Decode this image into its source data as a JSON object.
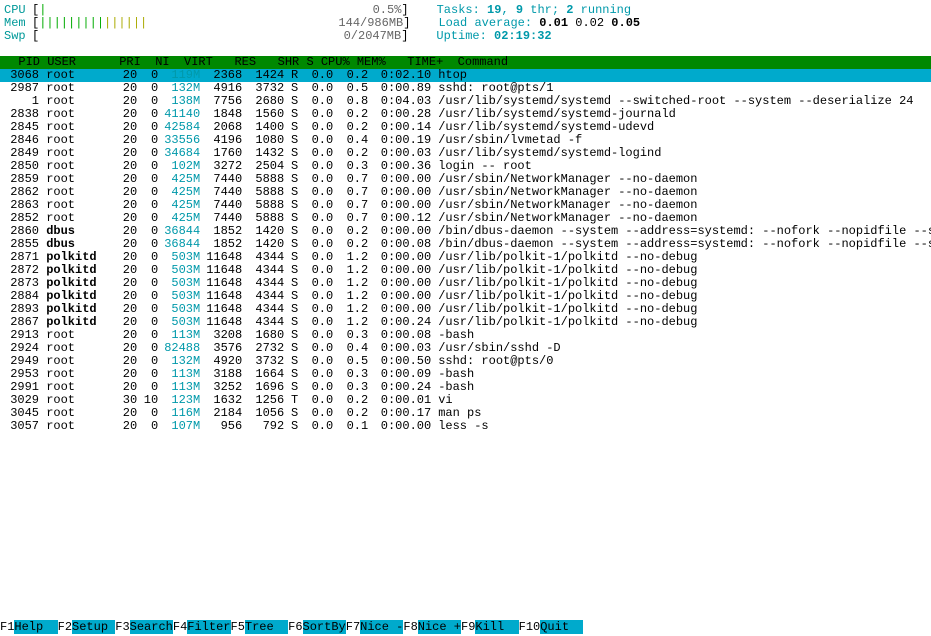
{
  "meters": {
    "cpu": {
      "label": "CPU",
      "bar": "|",
      "value": "0.5%"
    },
    "mem": {
      "label": "Mem",
      "bar_green": "|||||||||",
      "bar_yellow": "||||||",
      "value": "144/986MB"
    },
    "swp": {
      "label": "Swp",
      "bar": "",
      "value": "0/2047MB"
    }
  },
  "stats": {
    "tasks_label": "Tasks: ",
    "tasks_n": "19",
    "tasks_sep": ", ",
    "thr_n": "9",
    "thr_label": " thr; ",
    "running_n": "2",
    "running_label": " running",
    "load_label": "Load average: ",
    "load1": "0.01",
    "load2": "0.02",
    "load3": "0.05",
    "uptime_label": "Uptime: ",
    "uptime": "02:19:32"
  },
  "columns": "  PID USER      PRI  NI  VIRT   RES   SHR S CPU% MEM%   TIME+  Command",
  "processes": [
    {
      "selected": true,
      "pid": "3068",
      "user": "root",
      "pri": "20",
      "ni": "0",
      "virt": "119M",
      "res": "2368",
      "shr": "1424",
      "s": "R",
      "cpu": "0.0",
      "mem": "0.2",
      "time": "0:02.10",
      "cmd": "htop"
    },
    {
      "pid": "2987",
      "user": "root",
      "pri": "20",
      "ni": "0",
      "virt": "132M",
      "res": "4916",
      "shr": "3732",
      "s": "S",
      "cpu": "0.0",
      "mem": "0.5",
      "time": "0:00.89",
      "cmd": "sshd: root@pts/1"
    },
    {
      "pid": "1",
      "user": "root",
      "pri": "20",
      "ni": "0",
      "virt": "138M",
      "res": "7756",
      "shr": "2680",
      "s": "S",
      "cpu": "0.0",
      "mem": "0.8",
      "time": "0:04.03",
      "cmd": "/usr/lib/systemd/systemd --switched-root --system --deserialize 24"
    },
    {
      "pid": "2838",
      "user": "root",
      "pri": "20",
      "ni": "0",
      "virt": "41140",
      "res": "1848",
      "shr": "1560",
      "s": "S",
      "cpu": "0.0",
      "mem": "0.2",
      "time": "0:00.28",
      "cmd": "/usr/lib/systemd/systemd-journald"
    },
    {
      "pid": "2845",
      "user": "root",
      "pri": "20",
      "ni": "0",
      "virt": "42584",
      "res": "2068",
      "shr": "1400",
      "s": "S",
      "cpu": "0.0",
      "mem": "0.2",
      "time": "0:00.14",
      "cmd": "/usr/lib/systemd/systemd-udevd"
    },
    {
      "pid": "2846",
      "user": "root",
      "pri": "20",
      "ni": "0",
      "virt": "33556",
      "res": "4196",
      "shr": "1080",
      "s": "S",
      "cpu": "0.0",
      "mem": "0.4",
      "time": "0:00.19",
      "cmd": "/usr/sbin/lvmetad -f"
    },
    {
      "pid": "2849",
      "user": "root",
      "pri": "20",
      "ni": "0",
      "virt": "34684",
      "res": "1760",
      "shr": "1432",
      "s": "S",
      "cpu": "0.0",
      "mem": "0.2",
      "time": "0:00.03",
      "cmd": "/usr/lib/systemd/systemd-logind"
    },
    {
      "pid": "2850",
      "user": "root",
      "pri": "20",
      "ni": "0",
      "virt": "102M",
      "res": "3272",
      "shr": "2504",
      "s": "S",
      "cpu": "0.0",
      "mem": "0.3",
      "time": "0:00.36",
      "cmd": "login -- root"
    },
    {
      "pid": "2859",
      "user": "root",
      "pri": "20",
      "ni": "0",
      "virt": "425M",
      "res": "7440",
      "shr": "5888",
      "s": "S",
      "cpu": "0.0",
      "mem": "0.7",
      "time": "0:00.00",
      "cmd": "/usr/sbin/NetworkManager --no-daemon"
    },
    {
      "pid": "2862",
      "user": "root",
      "pri": "20",
      "ni": "0",
      "virt": "425M",
      "res": "7440",
      "shr": "5888",
      "s": "S",
      "cpu": "0.0",
      "mem": "0.7",
      "time": "0:00.00",
      "cmd": "/usr/sbin/NetworkManager --no-daemon"
    },
    {
      "pid": "2863",
      "user": "root",
      "pri": "20",
      "ni": "0",
      "virt": "425M",
      "res": "7440",
      "shr": "5888",
      "s": "S",
      "cpu": "0.0",
      "mem": "0.7",
      "time": "0:00.00",
      "cmd": "/usr/sbin/NetworkManager --no-daemon"
    },
    {
      "pid": "2852",
      "user": "root",
      "pri": "20",
      "ni": "0",
      "virt": "425M",
      "res": "7440",
      "shr": "5888",
      "s": "S",
      "cpu": "0.0",
      "mem": "0.7",
      "time": "0:00.12",
      "cmd": "/usr/sbin/NetworkManager --no-daemon"
    },
    {
      "pid": "2860",
      "user": "dbus",
      "bold_user": true,
      "pri": "20",
      "ni": "0",
      "virt": "36844",
      "res": "1852",
      "shr": "1420",
      "s": "S",
      "cpu": "0.0",
      "mem": "0.2",
      "time": "0:00.00",
      "cmd": "/bin/dbus-daemon --system --address=systemd: --nofork --nopidfile --s"
    },
    {
      "pid": "2855",
      "user": "dbus",
      "bold_user": true,
      "pri": "20",
      "ni": "0",
      "virt": "36844",
      "res": "1852",
      "shr": "1420",
      "s": "S",
      "cpu": "0.0",
      "mem": "0.2",
      "time": "0:00.08",
      "cmd": "/bin/dbus-daemon --system --address=systemd: --nofork --nopidfile --s"
    },
    {
      "pid": "2871",
      "user": "polkitd",
      "bold_user": true,
      "pri": "20",
      "ni": "0",
      "virt": "503M",
      "res": "11648",
      "shr": "4344",
      "s": "S",
      "cpu": "0.0",
      "mem": "1.2",
      "time": "0:00.00",
      "cmd": "/usr/lib/polkit-1/polkitd --no-debug"
    },
    {
      "pid": "2872",
      "user": "polkitd",
      "bold_user": true,
      "pri": "20",
      "ni": "0",
      "virt": "503M",
      "res": "11648",
      "shr": "4344",
      "s": "S",
      "cpu": "0.0",
      "mem": "1.2",
      "time": "0:00.00",
      "cmd": "/usr/lib/polkit-1/polkitd --no-debug"
    },
    {
      "pid": "2873",
      "user": "polkitd",
      "bold_user": true,
      "pri": "20",
      "ni": "0",
      "virt": "503M",
      "res": "11648",
      "shr": "4344",
      "s": "S",
      "cpu": "0.0",
      "mem": "1.2",
      "time": "0:00.00",
      "cmd": "/usr/lib/polkit-1/polkitd --no-debug"
    },
    {
      "pid": "2884",
      "user": "polkitd",
      "bold_user": true,
      "pri": "20",
      "ni": "0",
      "virt": "503M",
      "res": "11648",
      "shr": "4344",
      "s": "S",
      "cpu": "0.0",
      "mem": "1.2",
      "time": "0:00.00",
      "cmd": "/usr/lib/polkit-1/polkitd --no-debug"
    },
    {
      "pid": "2893",
      "user": "polkitd",
      "bold_user": true,
      "pri": "20",
      "ni": "0",
      "virt": "503M",
      "res": "11648",
      "shr": "4344",
      "s": "S",
      "cpu": "0.0",
      "mem": "1.2",
      "time": "0:00.00",
      "cmd": "/usr/lib/polkit-1/polkitd --no-debug"
    },
    {
      "pid": "2867",
      "user": "polkitd",
      "bold_user": true,
      "pri": "20",
      "ni": "0",
      "virt": "503M",
      "res": "11648",
      "shr": "4344",
      "s": "S",
      "cpu": "0.0",
      "mem": "1.2",
      "time": "0:00.24",
      "cmd": "/usr/lib/polkit-1/polkitd --no-debug"
    },
    {
      "pid": "2913",
      "user": "root",
      "pri": "20",
      "ni": "0",
      "virt": "113M",
      "res": "3208",
      "shr": "1680",
      "s": "S",
      "cpu": "0.0",
      "mem": "0.3",
      "time": "0:00.08",
      "cmd": "-bash"
    },
    {
      "pid": "2924",
      "user": "root",
      "pri": "20",
      "ni": "0",
      "virt": "82488",
      "res": "3576",
      "shr": "2732",
      "s": "S",
      "cpu": "0.0",
      "mem": "0.4",
      "time": "0:00.03",
      "cmd": "/usr/sbin/sshd -D"
    },
    {
      "pid": "2949",
      "user": "root",
      "pri": "20",
      "ni": "0",
      "virt": "132M",
      "res": "4920",
      "shr": "3732",
      "s": "S",
      "cpu": "0.0",
      "mem": "0.5",
      "time": "0:00.50",
      "cmd": "sshd: root@pts/0"
    },
    {
      "pid": "2953",
      "user": "root",
      "pri": "20",
      "ni": "0",
      "virt": "113M",
      "res": "3188",
      "shr": "1664",
      "s": "S",
      "cpu": "0.0",
      "mem": "0.3",
      "time": "0:00.09",
      "cmd": "-bash"
    },
    {
      "pid": "2991",
      "user": "root",
      "pri": "20",
      "ni": "0",
      "virt": "113M",
      "res": "3252",
      "shr": "1696",
      "s": "S",
      "cpu": "0.0",
      "mem": "0.3",
      "time": "0:00.24",
      "cmd": "-bash"
    },
    {
      "pid": "3029",
      "user": "root",
      "pri": "30",
      "ni": "10",
      "virt": "123M",
      "res": "1632",
      "shr": "1256",
      "s": "T",
      "cpu": "0.0",
      "mem": "0.2",
      "time": "0:00.01",
      "cmd": "vi"
    },
    {
      "pid": "3045",
      "user": "root",
      "pri": "20",
      "ni": "0",
      "virt": "116M",
      "res": "2184",
      "shr": "1056",
      "s": "S",
      "cpu": "0.0",
      "mem": "0.2",
      "time": "0:00.17",
      "cmd": "man ps"
    },
    {
      "pid": "3057",
      "user": "root",
      "pri": "20",
      "ni": "0",
      "virt": "107M",
      "res": "956",
      "shr": "792",
      "s": "S",
      "cpu": "0.0",
      "mem": "0.1",
      "time": "0:00.00",
      "cmd": "less -s"
    }
  ],
  "footer": [
    {
      "key": "F1",
      "label": "Help  "
    },
    {
      "key": "F2",
      "label": "Setup "
    },
    {
      "key": "F3",
      "label": "Search"
    },
    {
      "key": "F4",
      "label": "Filter"
    },
    {
      "key": "F5",
      "label": "Tree  "
    },
    {
      "key": "F6",
      "label": "SortBy"
    },
    {
      "key": "F7",
      "label": "Nice -"
    },
    {
      "key": "F8",
      "label": "Nice +"
    },
    {
      "key": "F9",
      "label": "Kill  "
    },
    {
      "key": "F10",
      "label": "Quit  "
    }
  ]
}
